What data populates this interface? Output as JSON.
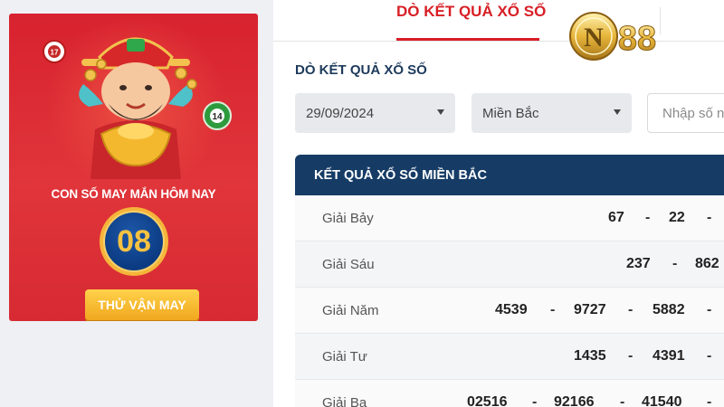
{
  "lucky": {
    "title": "CON SỐ MAY MẮN HÔM NAY",
    "number": "08",
    "button_label": "THỬ VẬN MAY",
    "ball_left": "17",
    "ball_right": "14"
  },
  "tabs": [
    {
      "label": "DÒ KẾT QUẢ XỔ SỐ",
      "active": true
    }
  ],
  "logo_text": "N88",
  "form": {
    "section_title": "DÒ KẾT QUẢ XỔ SỐ",
    "date_value": "29/09/2024",
    "region_value": "Miền Bắc",
    "number_placeholder": "Nhập số n"
  },
  "results": {
    "header": "KẾT QUẢ XỔ SỐ MIỀN BẮC",
    "rows": [
      {
        "prize": "Giải Bảy",
        "values": [
          "67",
          "22",
          ""
        ]
      },
      {
        "prize": "Giải Sáu",
        "values": [
          "237",
          "862"
        ]
      },
      {
        "prize": "Giải Năm",
        "values": [
          "4539",
          "9727",
          "5882",
          ""
        ]
      },
      {
        "prize": "Giải Tư",
        "values": [
          "1435",
          "4391",
          ""
        ]
      },
      {
        "prize": "Giải Ba",
        "values": [
          "02516",
          "92166",
          "41540",
          ""
        ]
      }
    ]
  },
  "colors": {
    "accent_red": "#d81f26",
    "header_navy": "#163c66",
    "lucky_bg": "#d8222f",
    "gold": "#f5b43a"
  },
  "icons": [
    "mascot-god-of-wealth",
    "lottery-ball-icon",
    "chevron-down-icon",
    "n88-logo"
  ]
}
